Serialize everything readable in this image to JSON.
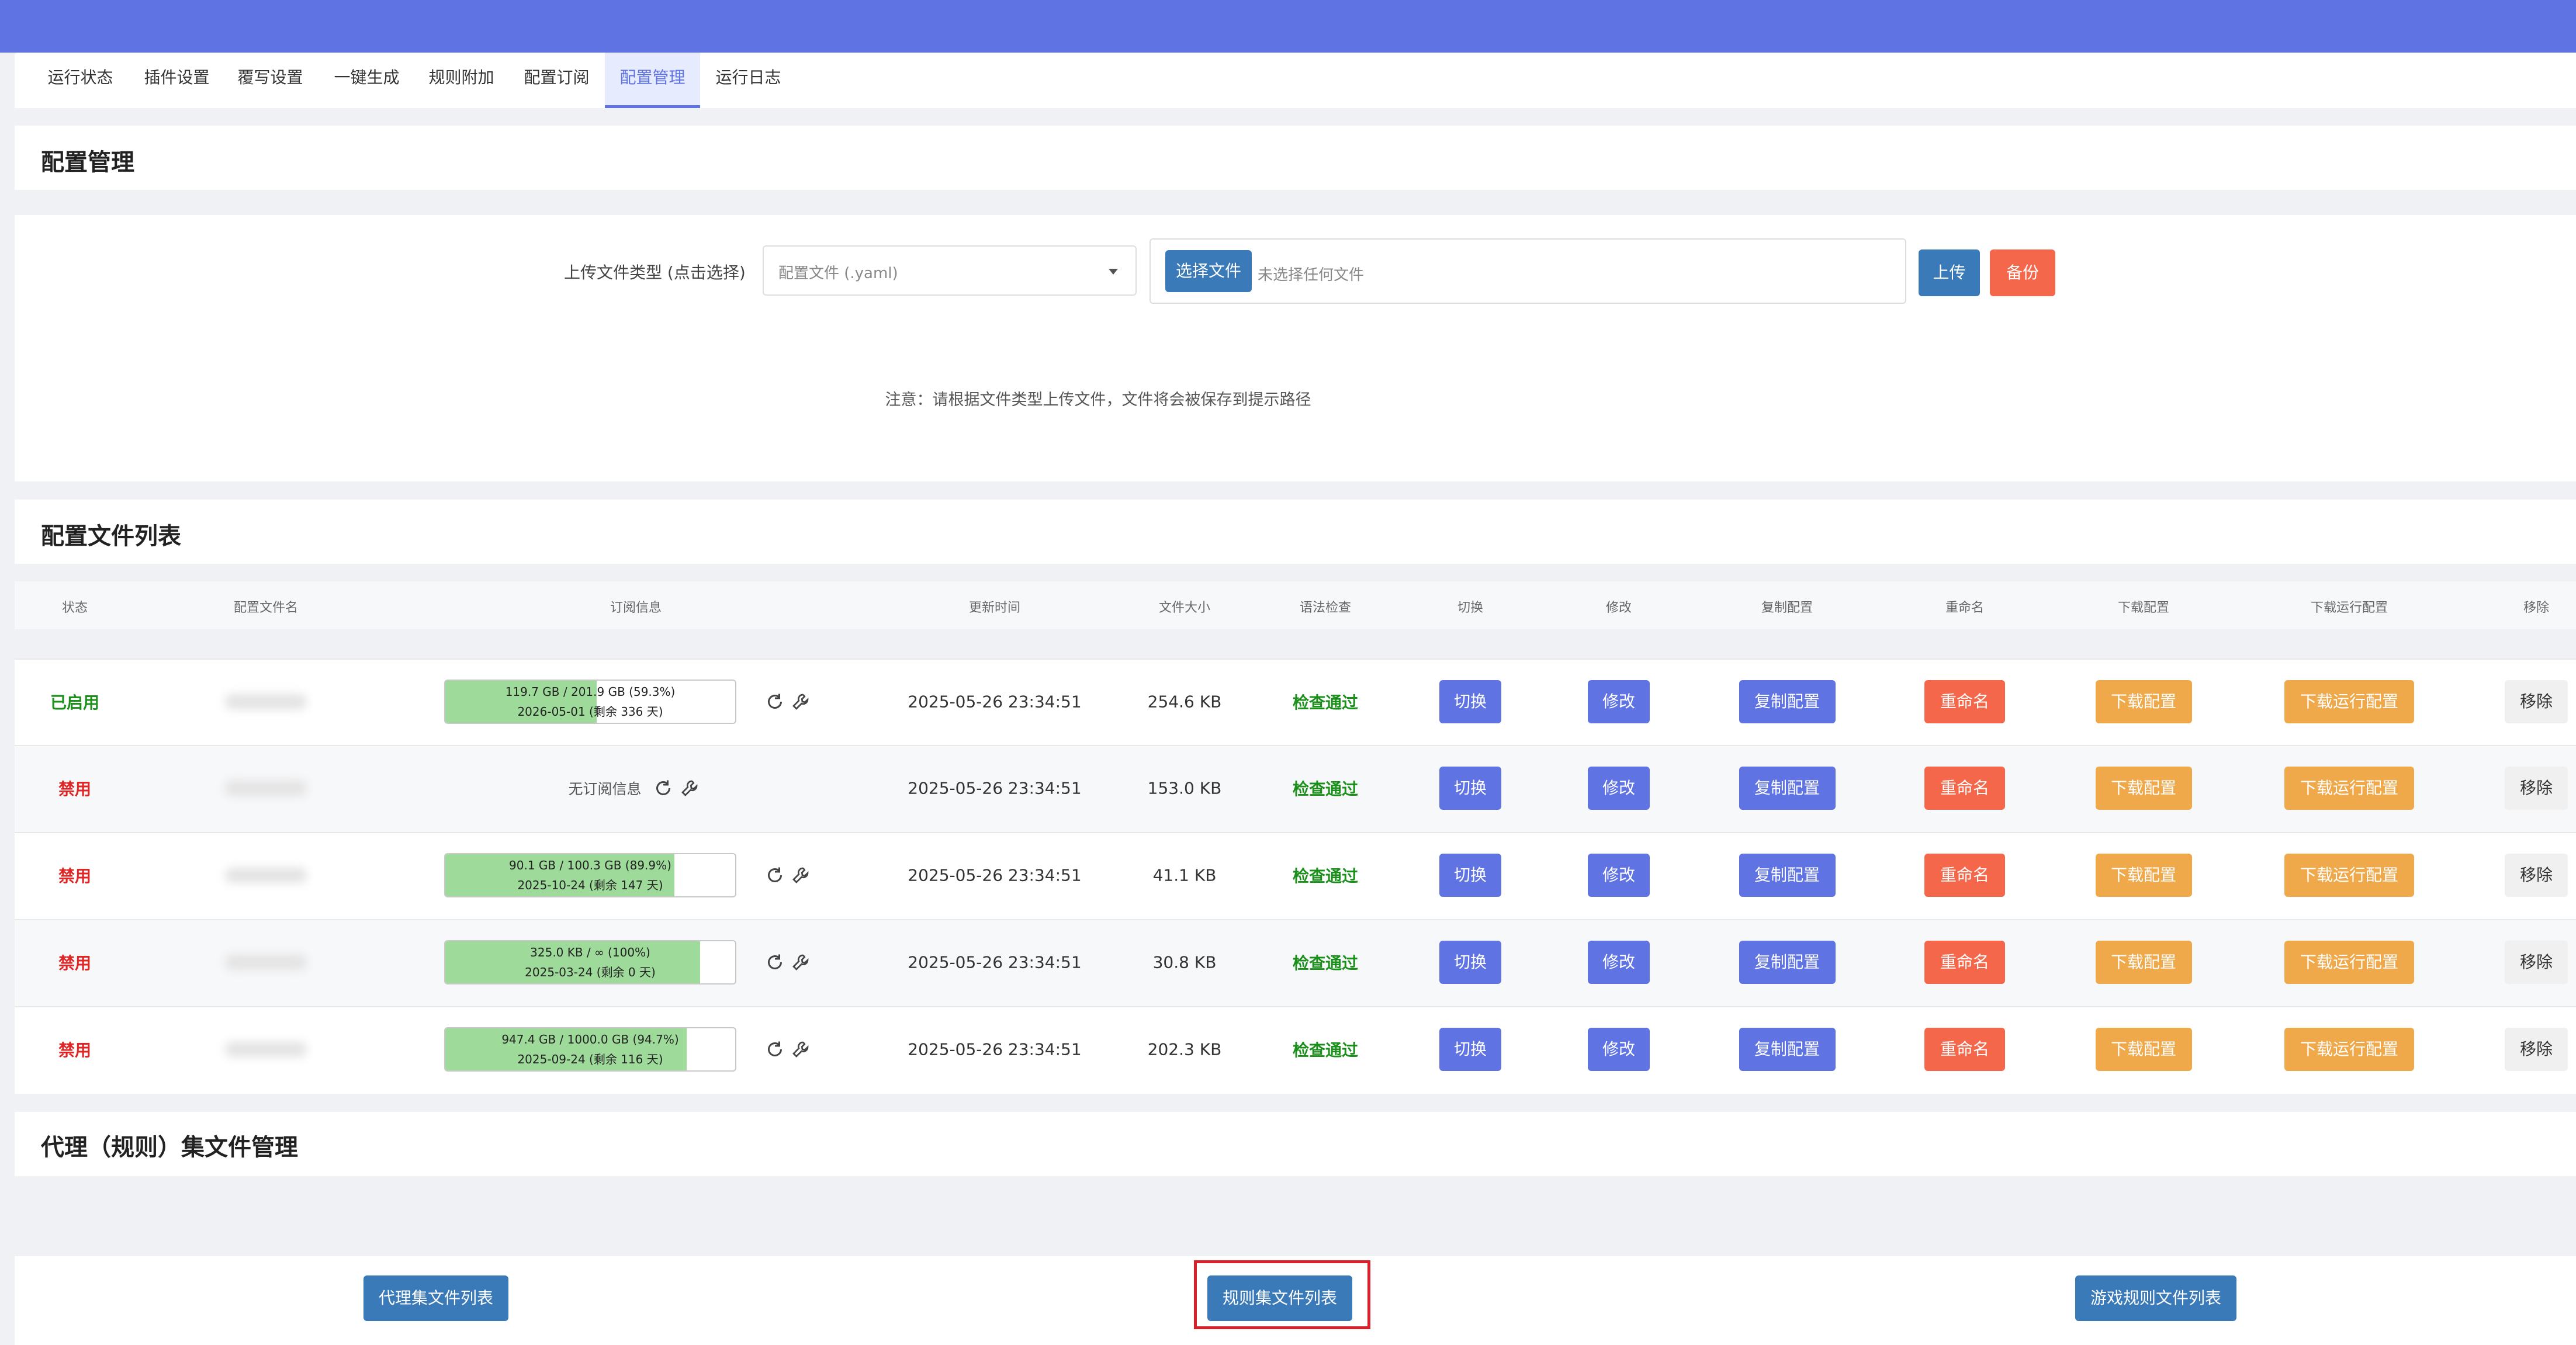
{
  "tabs": [
    "运行状态",
    "插件设置",
    "覆写设置",
    "一键生成",
    "规则附加",
    "配置订阅",
    "配置管理",
    "运行日志"
  ],
  "active_tab": "配置管理",
  "upload_section": {
    "title": "配置管理",
    "type_label": "上传文件类型 (点击选择)",
    "type_selected": "配置文件 (.yaml)",
    "choose_file_button": "选择文件",
    "no_file_text": "未选择任何文件",
    "upload_button": "上传",
    "backup_button": "备份",
    "note": "注意：请根据文件类型上传文件，文件将会被保存到提示路径"
  },
  "file_list": {
    "title": "配置文件列表",
    "columns": [
      "状态",
      "配置文件名",
      "订阅信息",
      "更新时间",
      "文件大小",
      "语法检查",
      "切换",
      "修改",
      "复制配置",
      "重命名",
      "下载配置",
      "下载运行配置",
      "移除"
    ],
    "actions": {
      "switch": "切换",
      "edit": "修改",
      "copy": "复制配置",
      "rename": "重命名",
      "download": "下载配置",
      "download_run": "下载运行配置",
      "remove": "移除"
    },
    "rows": [
      {
        "status": "已启用",
        "enabled": true,
        "sub_usage": "119.7 GB / 201.9 GB (59.3%)",
        "sub_expire": "2026-05-01 (剩余 336 天)",
        "sub_fraction": 0.593,
        "update_time": "2025-05-26 23:34:51",
        "size": "254.6 KB",
        "check": "检查通过"
      },
      {
        "status": "禁用",
        "enabled": false,
        "no_sub": "无订阅信息",
        "update_time": "2025-05-26 23:34:51",
        "size": "153.0 KB",
        "check": "检查通过"
      },
      {
        "status": "禁用",
        "enabled": false,
        "sub_usage": "90.1 GB / 100.3 GB (89.9%)",
        "sub_expire": "2025-10-24 (剩余 147 天)",
        "sub_fraction": 0.899,
        "update_time": "2025-05-26 23:34:51",
        "size": "41.1 KB",
        "check": "检查通过"
      },
      {
        "status": "禁用",
        "enabled": false,
        "sub_usage": "325.0 KB / ∞ (100%)",
        "sub_expire": "2025-03-24 (剩余 0 天)",
        "sub_fraction": 1.0,
        "update_time": "2025-05-26 23:34:51",
        "size": "30.8 KB",
        "check": "检查通过"
      },
      {
        "status": "禁用",
        "enabled": false,
        "sub_usage": "947.4 GB / 1000.0 GB (94.7%)",
        "sub_expire": "2025-09-24 (剩余 116 天)",
        "sub_fraction": 0.947,
        "update_time": "2025-05-26 23:34:51",
        "size": "202.3 KB",
        "check": "检查通过"
      }
    ]
  },
  "proxy_section": {
    "title": "代理（规则）集文件管理",
    "buttons": [
      "代理集文件列表",
      "规则集文件列表",
      "游戏规则文件列表"
    ]
  },
  "colors": {
    "header": "#5f73e3",
    "enabled": "#1a8f1a",
    "disabled": "#e02424",
    "progress_fill": "#9edb9a",
    "highlight_box": "#d9202a"
  },
  "icons": [
    "refresh-icon",
    "wrench-icon",
    "chevron-down-icon"
  ]
}
